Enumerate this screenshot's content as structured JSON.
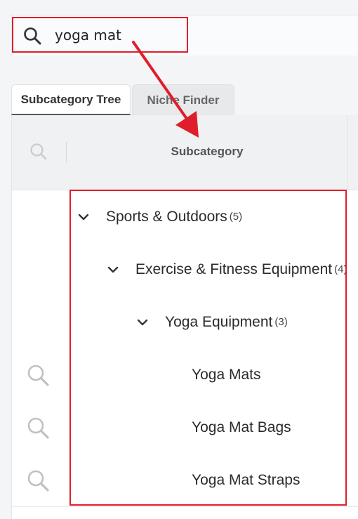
{
  "search": {
    "query": "yoga mat"
  },
  "tabs": [
    {
      "label": "Subcategory Tree",
      "active": true
    },
    {
      "label": "Niche Finder",
      "active": false
    }
  ],
  "table": {
    "header": "Subcategory",
    "rows": [
      {
        "label": "Sports & Outdoors",
        "count": "(5)",
        "level": 0,
        "expanded": true,
        "has_search": false
      },
      {
        "label": "Exercise & Fitness Equipment",
        "count": "(4)",
        "level": 1,
        "expanded": true,
        "has_search": false
      },
      {
        "label": "Yoga Equipment",
        "count": "(3)",
        "level": 2,
        "expanded": true,
        "has_search": false
      },
      {
        "label": "Yoga Mats",
        "count": "",
        "level": 3,
        "expanded": false,
        "has_search": true
      },
      {
        "label": "Yoga Mat Bags",
        "count": "",
        "level": 3,
        "expanded": false,
        "has_search": true
      },
      {
        "label": "Yoga Mat Straps",
        "count": "",
        "level": 3,
        "expanded": false,
        "has_search": true
      }
    ]
  },
  "colors": {
    "highlight": "#e01e2b",
    "accent": "#5a5a5a"
  }
}
